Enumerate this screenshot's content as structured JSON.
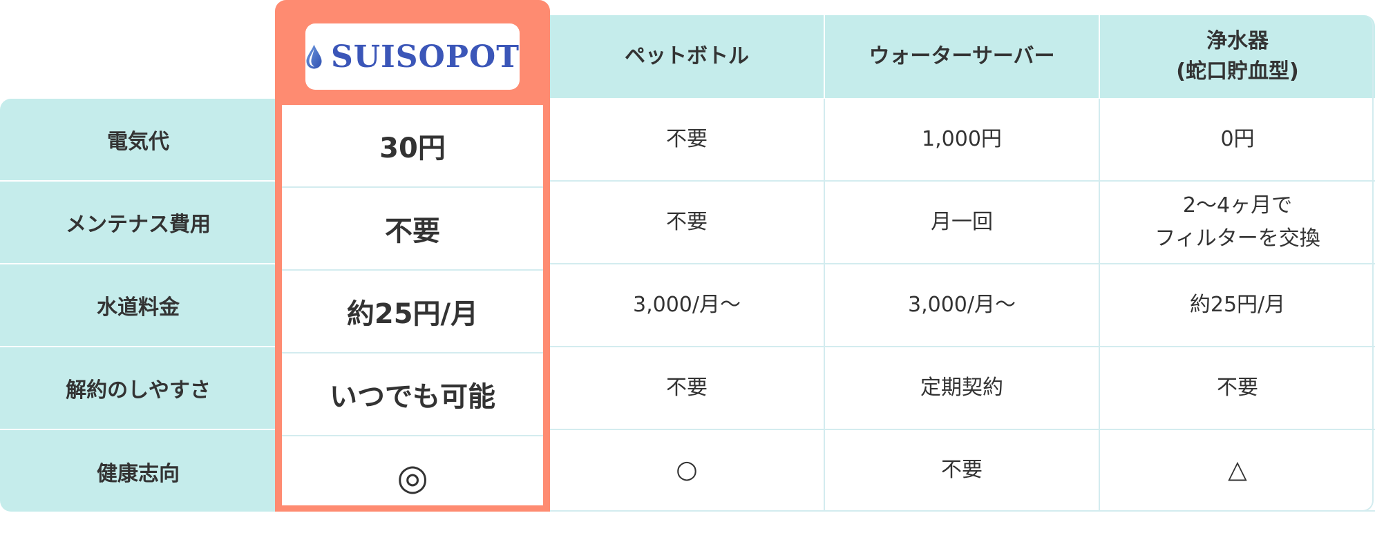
{
  "brand": {
    "name": "SUISOPOT",
    "logo_color": "#3b56b8",
    "highlight_color": "#fe8b71",
    "header_bg": "#c5eceb"
  },
  "columns": [
    "ペットボトル",
    "ウォーターサーバー",
    [
      "浄水器",
      "(蛇口貯血型)"
    ]
  ],
  "rows": [
    {
      "label": "電気代",
      "suisopot": "30円",
      "values": [
        "不要",
        "1,000円",
        "0円"
      ]
    },
    {
      "label": "メンテナス費用",
      "suisopot": "不要",
      "values": [
        "不要",
        "月一回",
        [
          "2〜4ヶ月で",
          "フィルターを交換"
        ]
      ]
    },
    {
      "label": "水道料金",
      "suisopot": "約25円/月",
      "values": [
        "3,000/月〜",
        "3,000/月〜",
        "約25円/月"
      ]
    },
    {
      "label": "解約のしやすさ",
      "suisopot": "いつでも可能",
      "values": [
        "不要",
        "定期契約",
        "不要"
      ]
    },
    {
      "label": "健康志向",
      "suisopot": "◎",
      "values": [
        "○",
        "不要",
        "△"
      ]
    }
  ]
}
